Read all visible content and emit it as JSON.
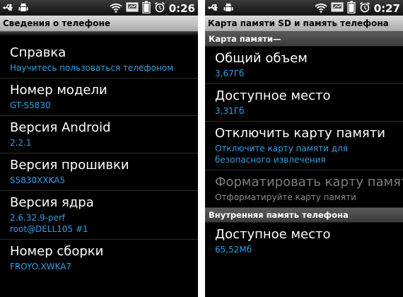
{
  "left": {
    "time": "0:26",
    "title": "Сведения о телефоне",
    "items": [
      {
        "title": "Справка",
        "subtitle": "Научитесь пользоваться телефоном"
      },
      {
        "title": "Номер модели",
        "subtitle": "GT-S5830"
      },
      {
        "title": "Версия Android",
        "subtitle": "2.2.1"
      },
      {
        "title": "Версия прошивки",
        "subtitle": "S5830XXKA5"
      },
      {
        "title": "Версия ядра",
        "subtitle": "2.6.32.9-perf",
        "subtitle2": "root@DELL105 #1"
      },
      {
        "title": "Номер сборки",
        "subtitle": "FROYO.XWKA7"
      }
    ]
  },
  "right": {
    "time": "0:27",
    "title": "Карта памяти SD и память телефона",
    "sections": [
      {
        "header": "Карта памяти—",
        "items": [
          {
            "title": "Общий объем",
            "subtitle": "3,67Гб"
          },
          {
            "title": "Доступное место",
            "subtitle": "3,31Гб"
          },
          {
            "title": "Отключить карту памяти",
            "subtitle": "Отключите карту памяти для безопасного извлечения"
          },
          {
            "title": "Форматировать карту памяти",
            "subtitle": "Отформатируйте карту памяти"
          }
        ]
      },
      {
        "header": "Внутренняя память телефона",
        "items": [
          {
            "title": "Доступное место",
            "subtitle": "65,52Мб"
          }
        ]
      }
    ]
  },
  "icons": {
    "usb": "usb-icon",
    "android": "android-debug-icon",
    "wifi": "wifi-icon",
    "sd": "sd-card-icon",
    "battery": "battery-icon",
    "alarm": "alarm-icon"
  },
  "colors": {
    "accent": "#2f9fe4",
    "background": "#000000",
    "disabled": "#7e7e7e"
  }
}
